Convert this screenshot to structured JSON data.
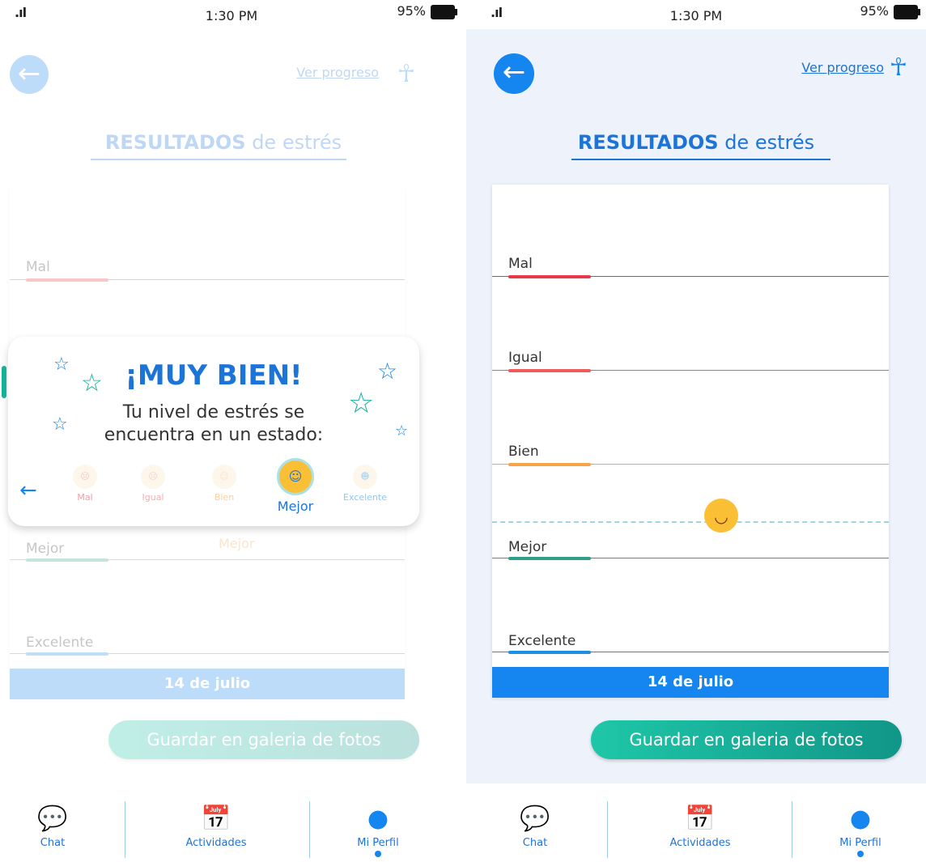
{
  "status": {
    "time": "1:30 PM",
    "battery": "95%"
  },
  "header": {
    "progress_link": "Ver progreso"
  },
  "title": {
    "strong": "RESULTADOS",
    "rest": " de estrés"
  },
  "levels": [
    {
      "label": "Mal",
      "color": "#e8394a"
    },
    {
      "label": "Igual",
      "color": "#ef5a5a"
    },
    {
      "label": "Bien",
      "color": "#f8a24a"
    },
    {
      "label": "Mejor",
      "color": "#2f9f87"
    },
    {
      "label": "Excelente",
      "color": "#1d8fe0"
    }
  ],
  "date": "14 de julio",
  "save_label": "Guardar en galeria de fotos",
  "faded_marker_label": "Mejor",
  "popup": {
    "title": "¡MUY BIEN!",
    "text1": "Tu nivel de estrés se",
    "text2": "encuentra en un estado:",
    "options": [
      "Mal",
      "Igual",
      "Bien",
      "Mejor",
      "Excelente"
    ],
    "selected": "Mejor"
  },
  "tabs": {
    "chat": "Chat",
    "activities": "Actividades",
    "profile": "Mi Perfil"
  }
}
